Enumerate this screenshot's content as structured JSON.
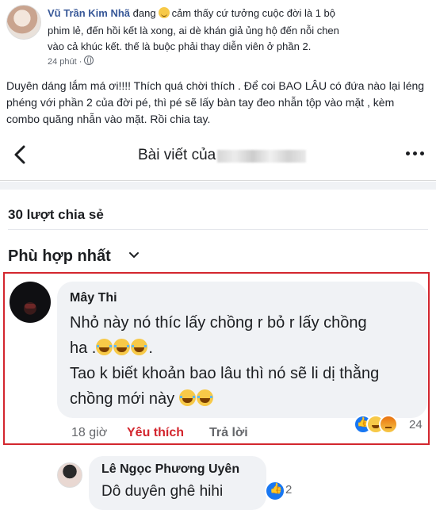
{
  "post": {
    "author": "Vũ Trần Kim Nhã",
    "feeling_prefix": "đang",
    "feeling_text": "cảm thấy cứ tưởng cuộc đời là 1 bộ",
    "line2": "phim lẻ, đến hồi kết là xong, ai dè khán giả ủng hộ đến nỗi chen",
    "line3": "vào cả khúc kết. thế là buộc phải thay diễn viên ở phần 2.",
    "time": "24 phút ·",
    "caption": "Duyên dáng lắm má ơi!!!! Thích quá chời thích . Để coi BAO LÂU có đứa nào lại léng phéng với phần 2 của đời pé, thì pé sẽ lấy bàn tay đeo nhẫn tộp vào mặt , kèm combo quăng nhẫn vào mặt. Rồi chia tay."
  },
  "screenshot": {
    "nav_title": "Bài viết của",
    "share_count": "30 lượt chia sẻ",
    "sort_label": "Phù hợp nhất",
    "comment": {
      "name": "Mây Thi",
      "line1": "Nhỏ này nó thíc lấy chồng r bỏ r lấy chồng",
      "line2": "ha .",
      "line2_end": ".",
      "line3": "Tao k biết khoản bao lâu thì nó sẽ li dị thằng",
      "line4": "chồng mới này",
      "time": "18 giờ",
      "like": "Yêu thích",
      "reply": "Trả lời",
      "reaction_count": "24"
    },
    "reply": {
      "name": "Lê Ngọc Phương Uyên",
      "text": "Dô duyên ghê hihi",
      "reaction_count": "2"
    }
  }
}
